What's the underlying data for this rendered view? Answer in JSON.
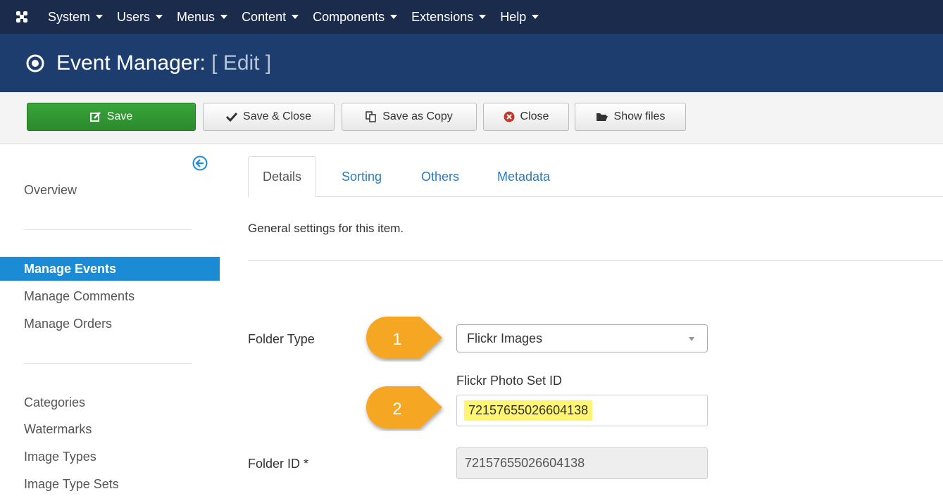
{
  "topbar": {
    "menus": [
      "System",
      "Users",
      "Menus",
      "Content",
      "Components",
      "Extensions",
      "Help"
    ]
  },
  "titlebar": {
    "title": "Event Manager:",
    "subtitle": "[ Edit ]"
  },
  "toolbar": {
    "save": "Save",
    "save_close": "Save & Close",
    "save_copy": "Save as Copy",
    "close": "Close",
    "show_files": "Show files"
  },
  "sidebar": {
    "overview": "Overview",
    "group1": [
      "Manage Events",
      "Manage Comments",
      "Manage Orders"
    ],
    "group2": [
      "Categories",
      "Watermarks",
      "Image Types",
      "Image Type Sets"
    ]
  },
  "tabs": [
    "Details",
    "Sorting",
    "Others",
    "Metadata"
  ],
  "main": {
    "description": "General settings for this item.",
    "folder_type_label": "Folder Type",
    "folder_type_value": "Flickr Images",
    "flickr_label": "Flickr Photo Set ID",
    "flickr_value": "72157655026604138",
    "folder_id_label": "Folder ID *",
    "folder_id_value": "72157655026604138"
  },
  "callouts": [
    "1",
    "2"
  ],
  "colors": {
    "topbar": "#1a2b4c",
    "titlebar": "#1c3d6e",
    "save_button": "#2f962f",
    "active_sidebar": "#1b8bd6",
    "callout": "#f5a623",
    "highlight": "#fff571"
  }
}
